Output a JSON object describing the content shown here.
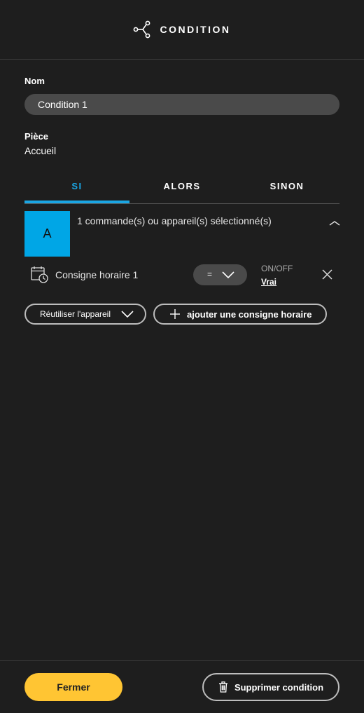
{
  "header": {
    "title": "CONDITION",
    "icon": "share-nodes-icon"
  },
  "form": {
    "name_label": "Nom",
    "name_value": "Condition 1",
    "room_label": "Pièce",
    "room_value": "Accueil"
  },
  "tabs": [
    {
      "label": "SI",
      "active": true
    },
    {
      "label": "ALORS",
      "active": false
    },
    {
      "label": "SINON",
      "active": false
    }
  ],
  "device": {
    "thumbnail_letter": "A",
    "thumbnail_color": "#00a6e6",
    "summary": "1 commande(s) ou appareil(s) sélectionné(s)"
  },
  "consigne": {
    "label": "Consigne horaire 1",
    "operator": "=",
    "state_label": "ON/OFF",
    "state_value": "Vrai"
  },
  "actions": {
    "reuse_label": "Réutiliser l'appareil",
    "add_label": "ajouter une consigne horaire"
  },
  "footer": {
    "close_label": "Fermer",
    "delete_label": "Supprimer condition"
  },
  "colors": {
    "accent": "#1aa6e4",
    "primary_button": "#ffc533",
    "background": "#1e1e1e"
  }
}
